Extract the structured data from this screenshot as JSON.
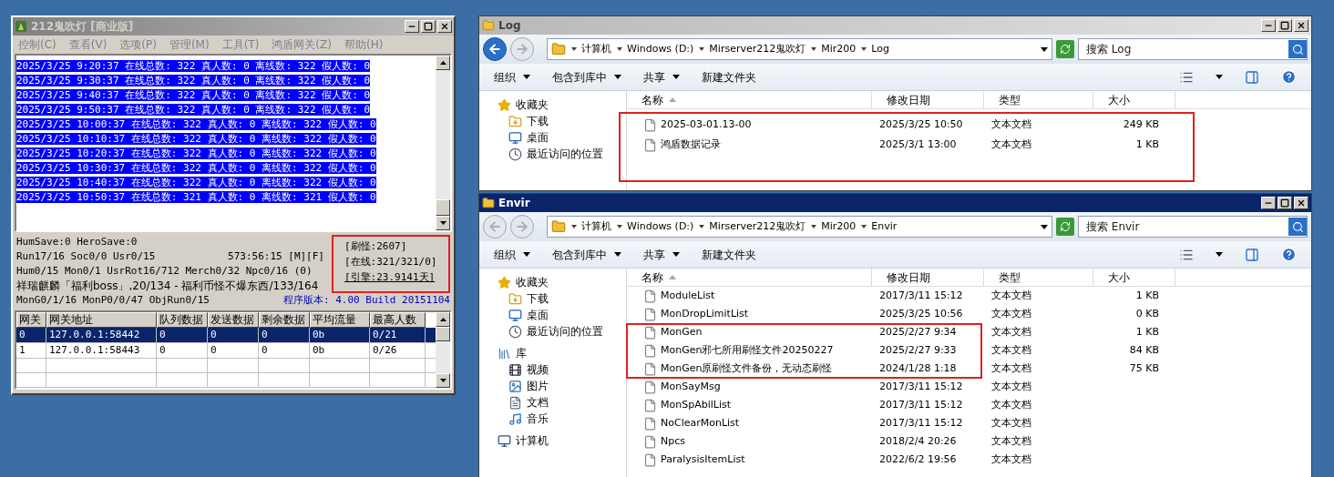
{
  "server_window": {
    "title": "212鬼吹灯 [商业版]",
    "active": false,
    "menu": [
      "控制(C)",
      "查看(V)",
      "选项(P)",
      "管理(M)",
      "工具(T)",
      "鸿盾网关(Z)",
      "帮助(H)"
    ],
    "log_lines": [
      {
        "text": "2025/3/25 9:20:37 在线总数: 322 真人数: 0 离线数: 322 假人数: 0",
        "selected": true
      },
      {
        "text": "2025/3/25 9:30:37 在线总数: 322 真人数: 0 离线数: 322 假人数: 0",
        "selected": true
      },
      {
        "text": "2025/3/25 9:40:37 在线总数: 322 真人数: 0 离线数: 322 假人数: 0",
        "selected": true
      },
      {
        "text": "2025/3/25 9:50:37 在线总数: 322 真人数: 0 离线数: 322 假人数: 0",
        "selected": true
      },
      {
        "text": "2025/3/25 10:00:37 在线总数: 322 真人数: 0 离线数: 322 假人数: 0",
        "selected": true
      },
      {
        "text": "2025/3/25 10:10:37 在线总数: 322 真人数: 0 离线数: 322 假人数: 0",
        "selected": true
      },
      {
        "text": "2025/3/25 10:20:37 在线总数: 322 真人数: 0 离线数: 322 假人数: 0",
        "selected": true
      },
      {
        "text": "2025/3/25 10:30:37 在线总数: 322 真人数: 0 离线数: 322 假人数: 0",
        "selected": true
      },
      {
        "text": "2025/3/25 10:40:37 在线总数: 322 真人数: 0 离线数: 322 假人数: 0",
        "selected": true
      },
      {
        "text": "2025/3/25 10:50:37 在线总数: 321 真人数: 0 离线数: 321 假人数: 0",
        "selected": true
      }
    ],
    "status_lines": [
      "HumSave:0 HeroSave:0",
      "Run17/16 Soc0/0 Usr0/15",
      "Hum0/15 Mon0/1 UsrRot16/712 Merch0/32 Npc0/16 (0)",
      "祥瑞麒麟「福利boss」,20/134 - 福利币怪不爆东西/133/164",
      "MonG0/1/16 MonP0/0/47 ObjRun0/15"
    ],
    "uptime": "573:56:15 [M][F]",
    "counters": [
      "[刷怪:2607]",
      "[在线:321/321/0]",
      "[引擎:23.9141天]"
    ],
    "version": "程序版本: 4.00 Build 20151104",
    "gateway_table": {
      "columns": [
        "网关",
        "网关地址",
        "队列数据",
        "发送数据",
        "剩余数据",
        "平均流量",
        "最高人数"
      ],
      "rows": [
        {
          "cells": [
            "0",
            "127.0.0.1:58442",
            "0",
            "0",
            "0",
            "0b",
            "0/21"
          ],
          "selected": true
        },
        {
          "cells": [
            "1",
            "127.0.0.1:58443",
            "0",
            "0",
            "0",
            "0b",
            "0/26"
          ],
          "selected": false
        }
      ]
    }
  },
  "log_window": {
    "title": "Log",
    "active": false,
    "back_enabled": true,
    "breadcrumb": [
      "计算机",
      "Windows (D:)",
      "Mirserver212鬼吹灯",
      "Mir200",
      "Log"
    ],
    "search_placeholder": "搜索 Log",
    "toolbar": [
      {
        "label": "组织",
        "dropdown": true
      },
      {
        "label": "包含到库中",
        "dropdown": true
      },
      {
        "label": "共享",
        "dropdown": true
      },
      {
        "label": "新建文件夹",
        "dropdown": false
      }
    ],
    "nav": [
      {
        "label": "收藏夹",
        "kind": "star",
        "children": [
          {
            "label": "下载",
            "kind": "download"
          },
          {
            "label": "桌面",
            "kind": "desktop"
          },
          {
            "label": "最近访问的位置",
            "kind": "recent"
          }
        ]
      }
    ],
    "columns": [
      "名称",
      "修改日期",
      "类型",
      "大小"
    ],
    "files": [
      {
        "name": "2025-03-01.13-00",
        "modified": "2025/3/25 10:50",
        "type": "文本文档",
        "size": "249 KB"
      },
      {
        "name": "鸿盾数据记录",
        "modified": "2025/3/1 13:00",
        "type": "文本文档",
        "size": "1 KB"
      }
    ]
  },
  "envir_window": {
    "title": "Envir",
    "active": true,
    "back_enabled": false,
    "breadcrumb": [
      "计算机",
      "Windows (D:)",
      "Mirserver212鬼吹灯",
      "Mir200",
      "Envir"
    ],
    "search_placeholder": "搜索 Envir",
    "toolbar": [
      {
        "label": "组织",
        "dropdown": true
      },
      {
        "label": "包含到库中",
        "dropdown": true
      },
      {
        "label": "共享",
        "dropdown": true
      },
      {
        "label": "新建文件夹",
        "dropdown": false
      }
    ],
    "nav": [
      {
        "label": "收藏夹",
        "kind": "star",
        "children": [
          {
            "label": "下载",
            "kind": "download"
          },
          {
            "label": "桌面",
            "kind": "desktop"
          },
          {
            "label": "最近访问的位置",
            "kind": "recent"
          }
        ]
      },
      {
        "label": "库",
        "kind": "library",
        "children": [
          {
            "label": "视频",
            "kind": "video"
          },
          {
            "label": "图片",
            "kind": "picture"
          },
          {
            "label": "文档",
            "kind": "document"
          },
          {
            "label": "音乐",
            "kind": "music"
          }
        ]
      },
      {
        "label": "计算机",
        "kind": "computer"
      }
    ],
    "columns": [
      "名称",
      "修改日期",
      "类型",
      "大小"
    ],
    "files": [
      {
        "name": "ModuleList",
        "modified": "2017/3/11 15:12",
        "type": "文本文档",
        "size": "1 KB"
      },
      {
        "name": "MonDropLimitList",
        "modified": "2025/3/25 10:56",
        "type": "文本文档",
        "size": "0 KB"
      },
      {
        "name": "MonGen",
        "modified": "2025/2/27 9:34",
        "type": "文本文档",
        "size": "1 KB"
      },
      {
        "name": "MonGen邪七所用刷怪文件20250227",
        "modified": "2025/2/27 9:33",
        "type": "文本文档",
        "size": "84 KB"
      },
      {
        "name": "MonGen原刷怪文件备份，无动态刷怪",
        "modified": "2024/1/28 1:18",
        "type": "文本文档",
        "size": "75 KB"
      },
      {
        "name": "MonSayMsg",
        "modified": "2017/3/11 15:12",
        "type": "文本文档"
      },
      {
        "name": "MonSpAbilList",
        "modified": "2017/3/11 15:12",
        "type": "文本文档"
      },
      {
        "name": "NoClearMonList",
        "modified": "2017/3/11 15:12",
        "type": "文本文档"
      },
      {
        "name": "Npcs",
        "modified": "2018/2/4 20:26",
        "type": "文本文档"
      },
      {
        "name": "ParalysisItemList",
        "modified": "2022/6/2 19:56",
        "type": "文本文档"
      }
    ]
  }
}
